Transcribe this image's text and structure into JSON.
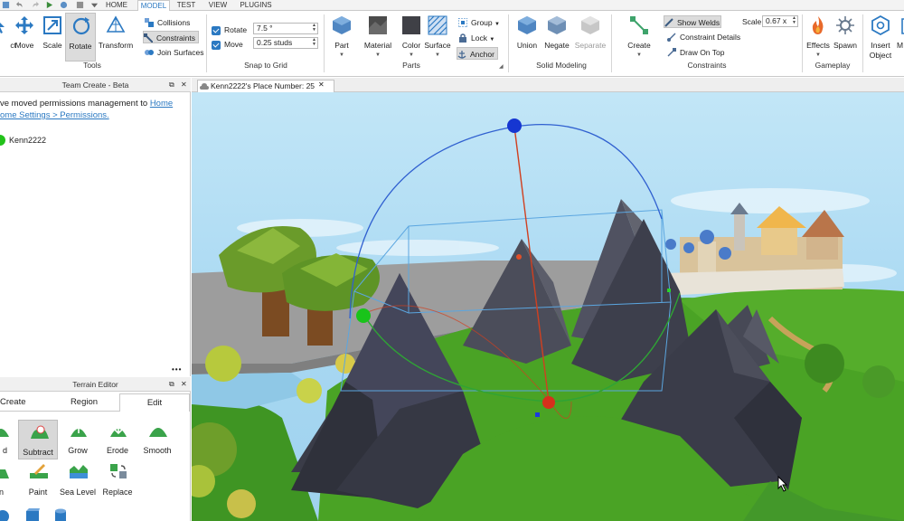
{
  "tabs": [
    {
      "label": "HOME",
      "active": false
    },
    {
      "label": "MODEL",
      "active": true
    },
    {
      "label": "TEST",
      "active": false
    },
    {
      "label": "VIEW",
      "active": false
    },
    {
      "label": "PLUGINS",
      "active": false
    }
  ],
  "tools_group": {
    "label": "Tools",
    "select_partial": "ct",
    "move": "Move",
    "scale": "Scale",
    "rotate": "Rotate",
    "transform": "Transform",
    "collisions": "Collisions",
    "constraints": "Constraints",
    "join_surfaces": "Join Surfaces"
  },
  "snap_group": {
    "label": "Snap to Grid",
    "rotate_label": "Rotate",
    "rotate_value": "7.5 °",
    "rotate_checked": true,
    "move_label": "Move",
    "move_value": "0.25 studs",
    "move_checked": true
  },
  "parts_group": {
    "label": "Parts",
    "part": "Part",
    "material": "Material",
    "color": "Color",
    "surface": "Surface",
    "group": "Group",
    "lock": "Lock",
    "anchor": "Anchor"
  },
  "solid_group": {
    "label": "Solid Modeling",
    "union": "Union",
    "negate": "Negate",
    "separate": "Separate"
  },
  "constraints_group": {
    "label": "Constraints",
    "create": "Create",
    "show_welds": "Show Welds",
    "constraint_details": "Constraint Details",
    "draw_on_top": "Draw On Top",
    "scale_label": "Scale",
    "scale_value": "0.67 x"
  },
  "gameplay_group": {
    "label": "Gameplay",
    "effects": "Effects",
    "spawn": "Spawn"
  },
  "insert_group": {
    "insert_object_line1": "Insert",
    "insert_object_line2": "Object",
    "partial": "M"
  },
  "team_create": {
    "title": "Team Create - Beta",
    "message_line1": "ve moved permissions management to ",
    "link1": "Home",
    "link2": "ome Settings > Permissions.",
    "user": "Kenn2222",
    "user_color": "#22c21a"
  },
  "terrain_editor": {
    "title": "Terrain Editor",
    "tabs": [
      "Create",
      "Region",
      "Edit"
    ],
    "active_tab": "Edit",
    "row1": [
      "d",
      "Subtract",
      "Grow",
      "Erode",
      "Smooth"
    ],
    "row2": [
      "ten",
      "Paint",
      "Sea Level",
      "Replace"
    ],
    "selected_tool": "Subtract"
  },
  "document_tab": {
    "title": "Kenn2222's Place Number: 25",
    "close": "✕"
  },
  "colors": {
    "accent": "#2b79c2",
    "sky": "#aadcf2",
    "grass": "#48a024",
    "rock": "#3d3f4c"
  }
}
